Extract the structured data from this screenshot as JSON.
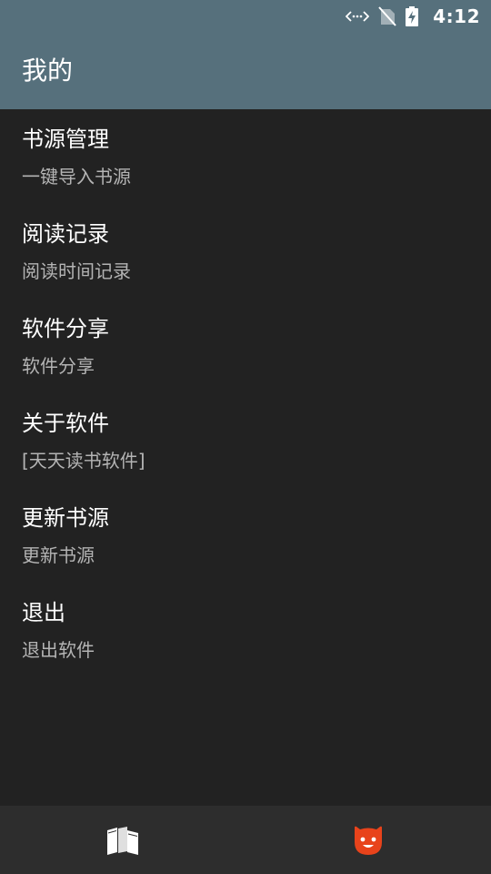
{
  "status_bar": {
    "time": "4:12",
    "icons": [
      "data-transfer-icon",
      "no-sim-icon",
      "battery-charging-icon"
    ]
  },
  "header": {
    "title": "我的"
  },
  "menu": {
    "items": [
      {
        "title": "书源管理",
        "subtitle": "一键导入书源"
      },
      {
        "title": "阅读记录",
        "subtitle": "阅读时间记录"
      },
      {
        "title": "软件分享",
        "subtitle": "软件分享"
      },
      {
        "title": "关于软件",
        "subtitle": "[天天读书软件]"
      },
      {
        "title": "更新书源",
        "subtitle": "更新书源"
      },
      {
        "title": "退出",
        "subtitle": "退出软件"
      }
    ]
  },
  "bottom_nav": {
    "tabs": [
      {
        "icon": "books-icon",
        "active": false
      },
      {
        "icon": "smiley-icon",
        "active": true
      }
    ]
  },
  "colors": {
    "app_bar": "#56707c",
    "background": "#222222",
    "bottom_nav": "#2d2d2d",
    "accent": "#e8431b",
    "subtitle_text": "#b4b4b4"
  }
}
